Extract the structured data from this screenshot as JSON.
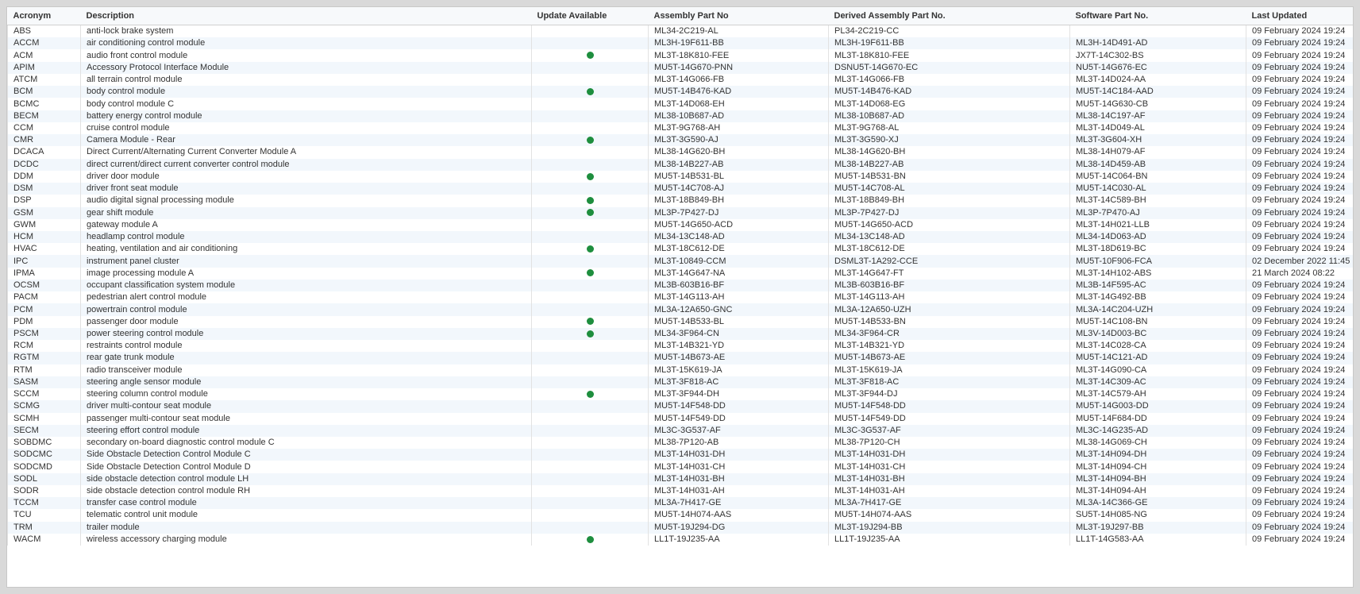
{
  "headers": {
    "acronym": "Acronym",
    "description": "Description",
    "update": "Update Available",
    "assembly": "Assembly Part No",
    "derived": "Derived Assembly Part No.",
    "software": "Software Part No.",
    "updated": "Last Updated"
  },
  "colors": {
    "update_dot": "#1e8e3e",
    "row_alt": "#f2f7fc"
  },
  "rows": [
    {
      "acr": "ABS",
      "desc": "anti-lock brake system",
      "upd": false,
      "asm": "ML34-2C219-AL",
      "der": "PL34-2C219-CC",
      "sw": "",
      "lu": "09 February 2024 19:24"
    },
    {
      "acr": "ACCM",
      "desc": "air conditioning control module",
      "upd": false,
      "asm": "ML3H-19F611-BB",
      "der": "ML3H-19F611-BB",
      "sw": "ML3H-14D491-AD",
      "lu": "09 February 2024 19:24"
    },
    {
      "acr": "ACM",
      "desc": "audio front control module",
      "upd": true,
      "asm": "ML3T-18K810-FEE",
      "der": "ML3T-18K810-FEE",
      "sw": "JX7T-14C302-BS",
      "lu": "09 February 2024 19:24"
    },
    {
      "acr": "APIM",
      "desc": "Accessory Protocol Interface Module",
      "upd": false,
      "asm": "MU5T-14G670-PNN",
      "der": "DSNU5T-14G670-EC",
      "sw": "NU5T-14G676-EC",
      "lu": "09 February 2024 19:24"
    },
    {
      "acr": "ATCM",
      "desc": "all terrain control module",
      "upd": false,
      "asm": "ML3T-14G066-FB",
      "der": "ML3T-14G066-FB",
      "sw": "ML3T-14D024-AA",
      "lu": "09 February 2024 19:24"
    },
    {
      "acr": "BCM",
      "desc": "body control module",
      "upd": true,
      "asm": "MU5T-14B476-KAD",
      "der": "MU5T-14B476-KAD",
      "sw": "MU5T-14C184-AAD",
      "lu": "09 February 2024 19:24"
    },
    {
      "acr": "BCMC",
      "desc": "body control module C",
      "upd": false,
      "asm": "ML3T-14D068-EH",
      "der": "ML3T-14D068-EG",
      "sw": "MU5T-14G630-CB",
      "lu": "09 February 2024 19:24"
    },
    {
      "acr": "BECM",
      "desc": "battery energy control module",
      "upd": false,
      "asm": "ML38-10B687-AD",
      "der": "ML38-10B687-AD",
      "sw": "ML38-14C197-AF",
      "lu": "09 February 2024 19:24"
    },
    {
      "acr": "CCM",
      "desc": "cruise control module",
      "upd": false,
      "asm": "ML3T-9G768-AH",
      "der": "ML3T-9G768-AL",
      "sw": "ML3T-14D049-AL",
      "lu": "09 February 2024 19:24"
    },
    {
      "acr": "CMR",
      "desc": "Camera Module - Rear",
      "upd": true,
      "asm": "ML3T-3G590-AJ",
      "der": "ML3T-3G590-XJ",
      "sw": "ML3T-3G604-XH",
      "lu": "09 February 2024 19:24"
    },
    {
      "acr": "DCACA",
      "desc": "Direct Current/Alternating Current Converter Module A",
      "upd": false,
      "asm": "ML38-14G620-BH",
      "der": "ML38-14G620-BH",
      "sw": "ML38-14H079-AF",
      "lu": "09 February 2024 19:24"
    },
    {
      "acr": "DCDC",
      "desc": "direct current/direct current converter control module",
      "upd": false,
      "asm": "ML38-14B227-AB",
      "der": "ML38-14B227-AB",
      "sw": "ML38-14D459-AB",
      "lu": "09 February 2024 19:24"
    },
    {
      "acr": "DDM",
      "desc": "driver door module",
      "upd": true,
      "asm": "MU5T-14B531-BL",
      "der": "MU5T-14B531-BN",
      "sw": "MU5T-14C064-BN",
      "lu": "09 February 2024 19:24"
    },
    {
      "acr": "DSM",
      "desc": "driver front seat module",
      "upd": false,
      "asm": "MU5T-14C708-AJ",
      "der": "MU5T-14C708-AL",
      "sw": "MU5T-14C030-AL",
      "lu": "09 February 2024 19:24"
    },
    {
      "acr": "DSP",
      "desc": "audio digital signal processing module",
      "upd": true,
      "asm": "ML3T-18B849-BH",
      "der": "ML3T-18B849-BH",
      "sw": "ML3T-14C589-BH",
      "lu": "09 February 2024 19:24"
    },
    {
      "acr": "GSM",
      "desc": "gear shift module",
      "upd": true,
      "asm": "ML3P-7P427-DJ",
      "der": "ML3P-7P427-DJ",
      "sw": "ML3P-7P470-AJ",
      "lu": "09 February 2024 19:24"
    },
    {
      "acr": "GWM",
      "desc": "gateway module A",
      "upd": false,
      "asm": "MU5T-14G650-ACD",
      "der": "MU5T-14G650-ACD",
      "sw": "ML3T-14H021-LLB",
      "lu": "09 February 2024 19:24"
    },
    {
      "acr": "HCM",
      "desc": "headlamp control module",
      "upd": false,
      "asm": "ML34-13C148-AD",
      "der": "ML34-13C148-AD",
      "sw": "ML34-14D063-AD",
      "lu": "09 February 2024 19:24"
    },
    {
      "acr": "HVAC",
      "desc": "heating, ventilation and air conditioning",
      "upd": true,
      "asm": "ML3T-18C612-DE",
      "der": "ML3T-18C612-DE",
      "sw": "ML3T-18D619-BC",
      "lu": "09 February 2024 19:24"
    },
    {
      "acr": "IPC",
      "desc": "instrument panel cluster",
      "upd": false,
      "asm": "ML3T-10849-CCM",
      "der": "DSML3T-1A292-CCE",
      "sw": "MU5T-10F906-FCA",
      "lu": "02 December 2022 11:45"
    },
    {
      "acr": "IPMA",
      "desc": "image processing module A",
      "upd": true,
      "asm": "ML3T-14G647-NA",
      "der": "ML3T-14G647-FT",
      "sw": "ML3T-14H102-ABS",
      "lu": "21 March 2024 08:22"
    },
    {
      "acr": "OCSM",
      "desc": "occupant classification system module",
      "upd": false,
      "asm": "ML3B-603B16-BF",
      "der": "ML3B-603B16-BF",
      "sw": "ML3B-14F595-AC",
      "lu": "09 February 2024 19:24"
    },
    {
      "acr": "PACM",
      "desc": "pedestrian alert control module",
      "upd": false,
      "asm": "ML3T-14G113-AH",
      "der": "ML3T-14G113-AH",
      "sw": "ML3T-14G492-BB",
      "lu": "09 February 2024 19:24"
    },
    {
      "acr": "PCM",
      "desc": "powertrain control module",
      "upd": false,
      "asm": "ML3A-12A650-GNC",
      "der": "ML3A-12A650-UZH",
      "sw": "ML3A-14C204-UZH",
      "lu": "09 February 2024 19:24"
    },
    {
      "acr": "PDM",
      "desc": "passenger door module",
      "upd": true,
      "asm": "MU5T-14B533-BL",
      "der": "MU5T-14B533-BN",
      "sw": "MU5T-14C108-BN",
      "lu": "09 February 2024 19:24"
    },
    {
      "acr": "PSCM",
      "desc": "power steering control module",
      "upd": true,
      "asm": "ML34-3F964-CN",
      "der": "ML34-3F964-CR",
      "sw": "ML3V-14D003-BC",
      "lu": "09 February 2024 19:24"
    },
    {
      "acr": "RCM",
      "desc": "restraints control module",
      "upd": false,
      "asm": "ML3T-14B321-YD",
      "der": "ML3T-14B321-YD",
      "sw": "ML3T-14C028-CA",
      "lu": "09 February 2024 19:24"
    },
    {
      "acr": "RGTM",
      "desc": "rear gate trunk module",
      "upd": false,
      "asm": "MU5T-14B673-AE",
      "der": "MU5T-14B673-AE",
      "sw": "MU5T-14C121-AD",
      "lu": "09 February 2024 19:24"
    },
    {
      "acr": "RTM",
      "desc": "radio transceiver module",
      "upd": false,
      "asm": "ML3T-15K619-JA",
      "der": "ML3T-15K619-JA",
      "sw": "ML3T-14G090-CA",
      "lu": "09 February 2024 19:24"
    },
    {
      "acr": "SASM",
      "desc": "steering angle sensor module",
      "upd": false,
      "asm": "ML3T-3F818-AC",
      "der": "ML3T-3F818-AC",
      "sw": "ML3T-14C309-AC",
      "lu": "09 February 2024 19:24"
    },
    {
      "acr": "SCCM",
      "desc": "steering column control module",
      "upd": true,
      "asm": "ML3T-3F944-DH",
      "der": "ML3T-3F944-DJ",
      "sw": "ML3T-14C579-AH",
      "lu": "09 February 2024 19:24"
    },
    {
      "acr": "SCMG",
      "desc": "driver multi-contour seat module",
      "upd": false,
      "asm": "MU5T-14F548-DD",
      "der": "MU5T-14F548-DD",
      "sw": "MU5T-14G003-DD",
      "lu": "09 February 2024 19:24"
    },
    {
      "acr": "SCMH",
      "desc": "passenger multi-contour seat module",
      "upd": false,
      "asm": "MU5T-14F549-DD",
      "der": "MU5T-14F549-DD",
      "sw": "MU5T-14F684-DD",
      "lu": "09 February 2024 19:24"
    },
    {
      "acr": "SECM",
      "desc": "steering effort control module",
      "upd": false,
      "asm": "ML3C-3G537-AF",
      "der": "ML3C-3G537-AF",
      "sw": "ML3C-14G235-AD",
      "lu": "09 February 2024 19:24"
    },
    {
      "acr": "SOBDMC",
      "desc": "secondary on-board diagnostic control module C",
      "upd": false,
      "asm": "ML38-7P120-AB",
      "der": "ML38-7P120-CH",
      "sw": "ML38-14G069-CH",
      "lu": "09 February 2024 19:24"
    },
    {
      "acr": "SODCMC",
      "desc": "Side Obstacle Detection Control Module C",
      "upd": false,
      "asm": "ML3T-14H031-DH",
      "der": "ML3T-14H031-DH",
      "sw": "ML3T-14H094-DH",
      "lu": "09 February 2024 19:24"
    },
    {
      "acr": "SODCMD",
      "desc": "Side Obstacle Detection Control Module D",
      "upd": false,
      "asm": "ML3T-14H031-CH",
      "der": "ML3T-14H031-CH",
      "sw": "ML3T-14H094-CH",
      "lu": "09 February 2024 19:24"
    },
    {
      "acr": "SODL",
      "desc": "side obstacle detection control module LH",
      "upd": false,
      "asm": "ML3T-14H031-BH",
      "der": "ML3T-14H031-BH",
      "sw": "ML3T-14H094-BH",
      "lu": "09 February 2024 19:24"
    },
    {
      "acr": "SODR",
      "desc": "side obstacle detection control module RH",
      "upd": false,
      "asm": "ML3T-14H031-AH",
      "der": "ML3T-14H031-AH",
      "sw": "ML3T-14H094-AH",
      "lu": "09 February 2024 19:24"
    },
    {
      "acr": "TCCM",
      "desc": "transfer case control module",
      "upd": false,
      "asm": "ML3A-7H417-GE",
      "der": "ML3A-7H417-GE",
      "sw": "ML3A-14C366-GE",
      "lu": "09 February 2024 19:24"
    },
    {
      "acr": "TCU",
      "desc": "telematic control unit module",
      "upd": false,
      "asm": "MU5T-14H074-AAS",
      "der": "MU5T-14H074-AAS",
      "sw": "SU5T-14H085-NG",
      "lu": "09 February 2024 19:24"
    },
    {
      "acr": "TRM",
      "desc": "trailer module",
      "upd": false,
      "asm": "MU5T-19J294-DG",
      "der": "ML3T-19J294-BB",
      "sw": "ML3T-19J297-BB",
      "lu": "09 February 2024 19:24"
    },
    {
      "acr": "WACM",
      "desc": "wireless accessory charging module",
      "upd": true,
      "asm": "LL1T-19J235-AA",
      "der": "LL1T-19J235-AA",
      "sw": "LL1T-14G583-AA",
      "lu": "09 February 2024 19:24"
    }
  ]
}
